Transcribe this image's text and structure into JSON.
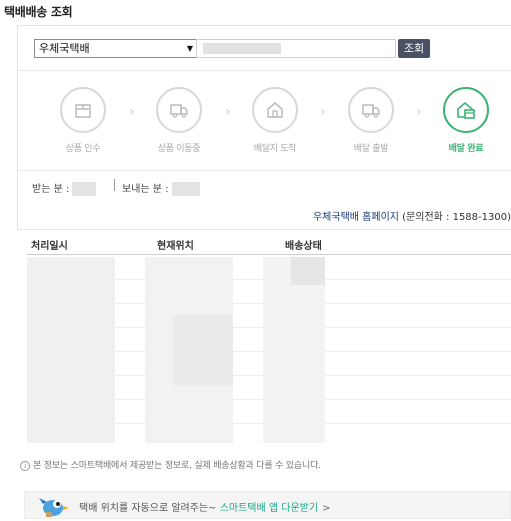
{
  "page": {
    "title": "택배배송 조회"
  },
  "search": {
    "carrier_selected": "우체국택배",
    "tracking_number": "",
    "button_label": "조회"
  },
  "steps": [
    {
      "label": "상품 인수",
      "icon": "box-icon",
      "active": false
    },
    {
      "label": "상품 이동중",
      "icon": "truck-icon",
      "active": false
    },
    {
      "label": "배달지 도착",
      "icon": "house-icon",
      "active": false
    },
    {
      "label": "배달 출발",
      "icon": "truck-icon",
      "active": false
    },
    {
      "label": "배달 완료",
      "icon": "house-box-icon",
      "active": true
    }
  ],
  "parties": {
    "recipient_label": "받는 분 :",
    "sender_label": "보내는 분 :"
  },
  "carrier_info": {
    "homepage_link": "우체국택배 홈페이지",
    "phone_text": "(문의전화 : 1588-1300)"
  },
  "table": {
    "columns": [
      "처리일시",
      "현재위치",
      "배송상태"
    ]
  },
  "notice": "본 정보는 스마트택배에서 제공받는 정보로, 실제 배송상황과 다를 수 있습니다.",
  "banner": {
    "text": "택배 위치를 자동으로 알려주는~",
    "link": "스마트택배 앱 다운받기",
    "chevron": ">"
  },
  "colors": {
    "accent_green": "#3cb371",
    "button_dark": "#4a5165",
    "link_teal": "#1aa88c"
  }
}
